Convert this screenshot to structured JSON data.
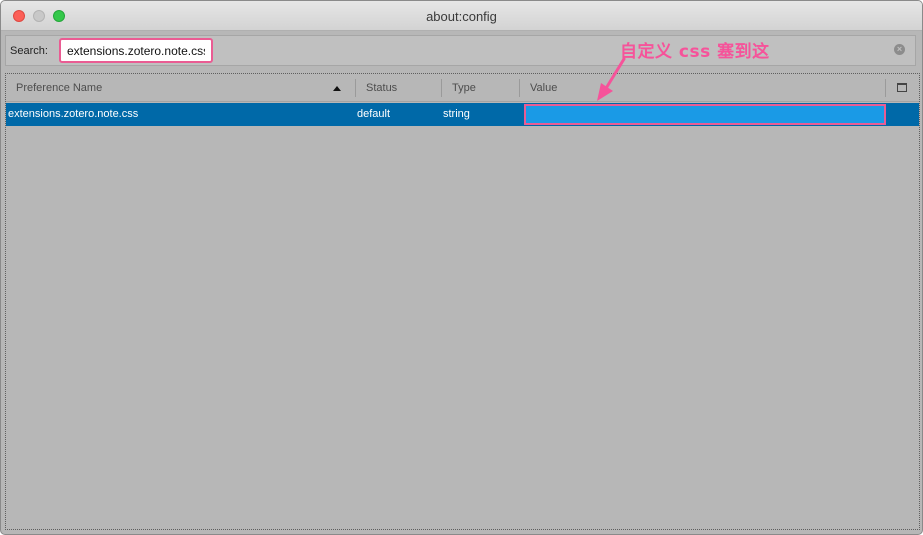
{
  "window": {
    "title": "about:config"
  },
  "search": {
    "label": "Search:",
    "value": "extensions.zotero.note.css",
    "clear_icon": "clear-circle-icon"
  },
  "table": {
    "columns": [
      {
        "label": "Preference Name",
        "sorted": "ascending"
      },
      {
        "label": "Status"
      },
      {
        "label": "Type"
      },
      {
        "label": "Value"
      }
    ],
    "column_picker_icon": "column-picker-icon",
    "rows": [
      {
        "name": "extensions.zotero.note.css",
        "status": "default",
        "type": "string",
        "value": "",
        "selected": true
      }
    ]
  },
  "annotation": {
    "text": "自定义 css 塞到这",
    "color": "#f6539a"
  },
  "colors": {
    "selection": "#0069a8",
    "value_editor": "#1a9ae6",
    "highlight_border": "#ea5c93"
  }
}
